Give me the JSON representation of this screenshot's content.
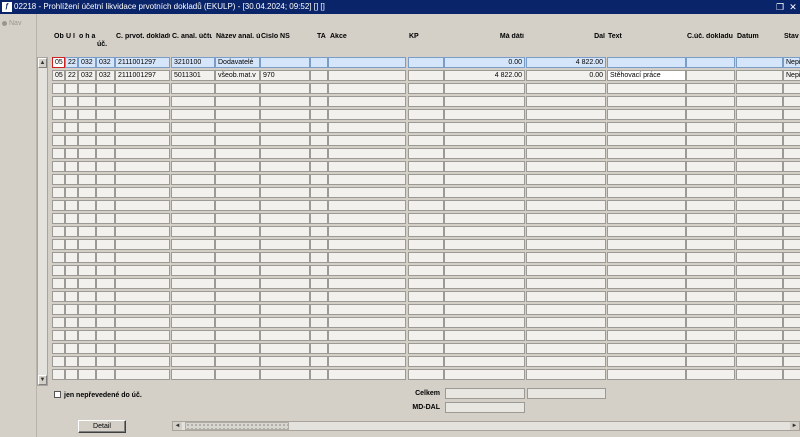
{
  "window": {
    "title": "02218 - Prohlížení účetní likvidace prvotních dokladů (EKULP) - [30.04.2024; 09:52]  [] []",
    "restore_glyph": "❐",
    "close_glyph": "✕"
  },
  "nav": {
    "label": "Nav"
  },
  "columns": [
    {
      "key": "obdobi",
      "label": "Ob do bí"
    },
    {
      "key": "ul",
      "label": "Ú l"
    },
    {
      "key": "oha_prv",
      "label": "o h a prv."
    },
    {
      "key": "uc",
      "label": "úč."
    },
    {
      "key": "c_prvot",
      "label": "Č. prvot. dokladu"
    },
    {
      "key": "c_anal",
      "label": "Č. anal. účtu"
    },
    {
      "key": "nazev",
      "label": "Název anal. účtu"
    },
    {
      "key": "cislo_ns",
      "label": "Číslo NS"
    },
    {
      "key": "ta",
      "label": "TA"
    },
    {
      "key": "akce",
      "label": "Akce"
    },
    {
      "key": "kp",
      "label": "KP"
    },
    {
      "key": "ma_dati",
      "label": "Má dáti"
    },
    {
      "key": "dal",
      "label": "Dal"
    },
    {
      "key": "text",
      "label": "Text"
    },
    {
      "key": "c_uc_dokladu",
      "label": "Č.úč. dokladu"
    },
    {
      "key": "datum",
      "label": "Datum"
    },
    {
      "key": "stav",
      "label": "Stav do ú"
    }
  ],
  "rows": [
    {
      "obdobi": "05",
      "ul": "22",
      "oha_prv": "032",
      "uc": "032",
      "c_prvot": "2111001297",
      "c_anal": "3210100",
      "nazev": "Dodavatelé",
      "cislo_ns": "",
      "ta": "",
      "akce": "",
      "kp": "",
      "ma_dati": "0.00",
      "dal": "4 822.00",
      "text": "",
      "c_uc_dokladu": "",
      "datum": "",
      "stav": "Nepř"
    },
    {
      "obdobi": "05",
      "ul": "22",
      "oha_prv": "032",
      "uc": "032",
      "c_prvot": "2111001297",
      "c_anal": "5011301",
      "nazev": "všeob.mat.v",
      "cislo_ns": "970",
      "ta": "",
      "akce": "",
      "kp": "",
      "ma_dati": "4 822.00",
      "dal": "0.00",
      "text": "Stěhovací práce",
      "c_uc_dokladu": "",
      "datum": "",
      "stav": "Nepř"
    }
  ],
  "empty_row_count": 23,
  "filter": {
    "checkbox_label": "jen nepřevedené do úč.",
    "checked": false
  },
  "summary": {
    "celkem_label": "Celkem",
    "mddal_label": "MD-DAL"
  },
  "buttons": {
    "detail_label": "Detail"
  },
  "icons": {
    "scroll_up": "▲",
    "scroll_down": "▼",
    "scroll_left": "◄",
    "scroll_right": "►"
  },
  "colors": {
    "titlebar": "#0a246a",
    "selected_row": "#d6e6fa",
    "focus_border": "#cc2222"
  }
}
